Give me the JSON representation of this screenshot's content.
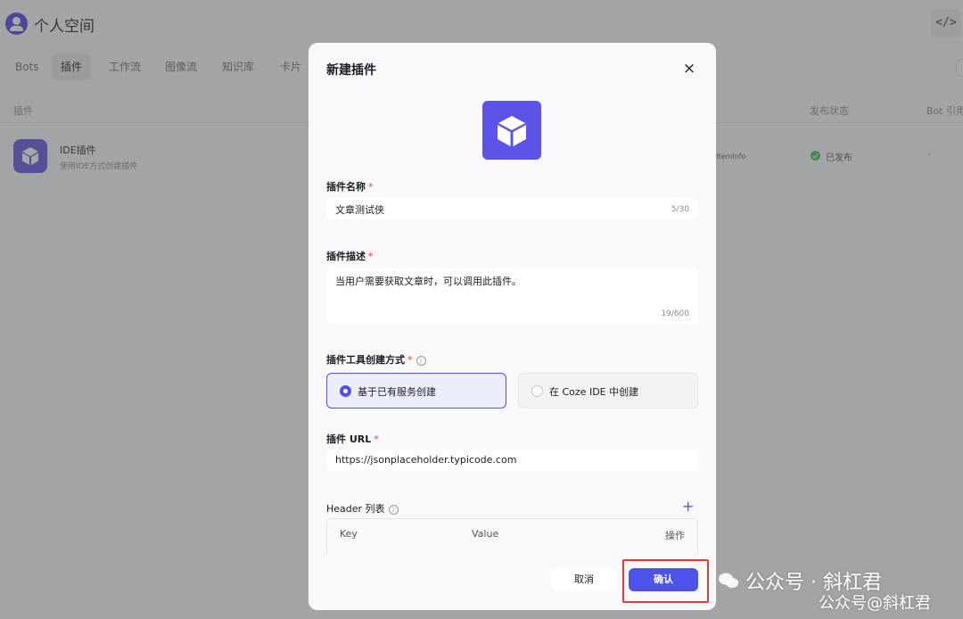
{
  "header": {
    "title": "个人空间",
    "code_icon": "</>"
  },
  "tabs": [
    {
      "label": "Bots",
      "active": false
    },
    {
      "label": "插件",
      "active": true
    },
    {
      "label": "工作流",
      "active": false
    },
    {
      "label": "图像流",
      "active": false
    },
    {
      "label": "知识库",
      "active": false
    },
    {
      "label": "卡片",
      "active": false
    }
  ],
  "table": {
    "columns": {
      "plugin": "插件",
      "status": "发布状态",
      "bot": "Bot 引用"
    },
    "rows": [
      {
        "name": "IDE插件",
        "desc": "使用IDE方式创建插件",
        "api": "getItemInfo",
        "status": "已发布",
        "bot": "-"
      }
    ]
  },
  "modal": {
    "title": "新建插件",
    "close_icon": "×",
    "fields": {
      "name": {
        "label": "插件名称",
        "required": "*",
        "value": "文章测试侠",
        "counter": "5/30"
      },
      "desc": {
        "label": "插件描述",
        "required": "*",
        "value": "当用户需要获取文章时，可以调用此插件。",
        "counter": "19/600"
      },
      "method": {
        "label": "插件工具创建方式",
        "required": "*",
        "options": [
          {
            "label": "基于已有服务创建",
            "selected": true
          },
          {
            "label": "在 Coze IDE 中创建",
            "selected": false
          }
        ]
      },
      "url": {
        "label": "插件 URL",
        "required": "*",
        "value": "https://jsonplaceholder.typicode.com"
      },
      "headers": {
        "label": "Header 列表",
        "add_icon": "+",
        "columns": {
          "key": "Key",
          "value": "Value",
          "action": "操作"
        }
      }
    },
    "buttons": {
      "cancel": "取消",
      "confirm": "确认"
    }
  },
  "watermark": {
    "line1": "公众号 · 斜杠君",
    "line2": "公众号@斜杠君"
  },
  "colors": {
    "accent": "#4d53e8",
    "required": "#f93920",
    "success": "#3cbf6a",
    "highlight": "#e03c3c"
  }
}
